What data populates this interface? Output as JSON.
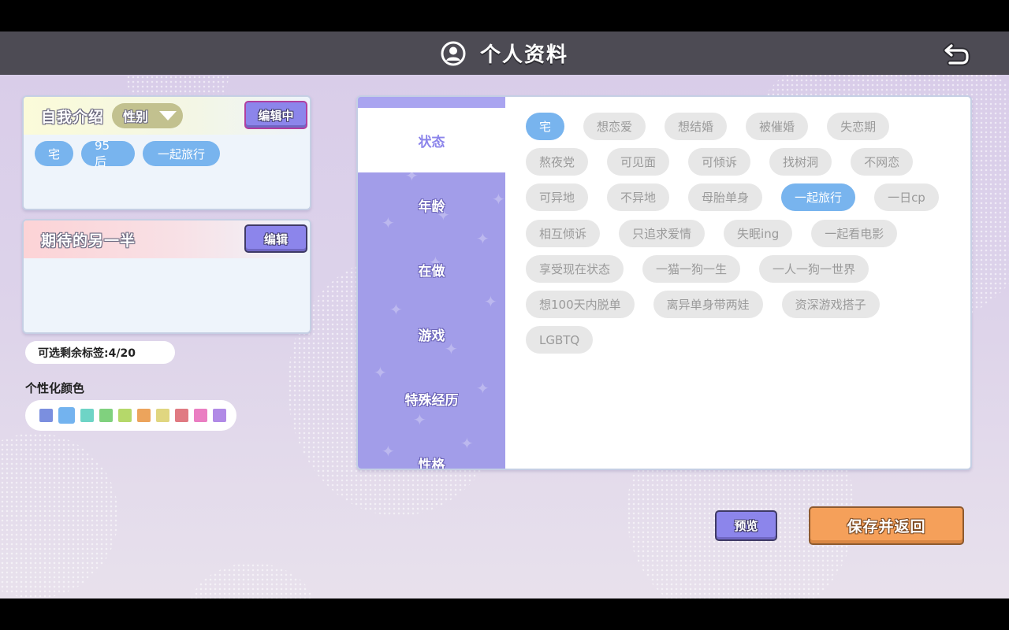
{
  "header": {
    "title": "个人资料",
    "profile_icon": "user-circle-icon",
    "back_icon": "return-arrow-icon"
  },
  "intro_card": {
    "title": "自我介绍",
    "gender_label": "性别",
    "edit_button": "编辑中",
    "selected_tags": [
      "宅",
      "95后",
      "一起旅行"
    ]
  },
  "partner_card": {
    "title": "期待的另一半",
    "edit_button": "编辑"
  },
  "remaining_tags": "可选剩余标签:4/20",
  "colors": {
    "label": "个性化颜色",
    "swatches": [
      "#7b8fdf",
      "#73b3ef",
      "#6ed4c6",
      "#80d17e",
      "#b5d86a",
      "#eca45c",
      "#e0d680",
      "#e07a82",
      "#ea7ec2",
      "#b18ae6"
    ],
    "selected_index": 1,
    "accent_purple": "#8c85eb",
    "accent_orange": "#f5a05a",
    "tag_selected_blue": "#78b4ee"
  },
  "categories": {
    "items": [
      "状态",
      "年龄",
      "在做",
      "游戏",
      "特殊经历",
      "性格"
    ],
    "active_index": 0
  },
  "tags": {
    "rows": [
      [
        {
          "label": "宅",
          "sel": true
        },
        {
          "label": "想恋爱"
        },
        {
          "label": "想结婚"
        },
        {
          "label": "被催婚"
        },
        {
          "label": "失恋期"
        }
      ],
      [
        {
          "label": "熬夜党"
        },
        {
          "label": "可见面"
        },
        {
          "label": "可倾诉"
        },
        {
          "label": "找树洞"
        },
        {
          "label": "不网恋"
        }
      ],
      [
        {
          "label": "可异地"
        },
        {
          "label": "不异地"
        },
        {
          "label": "母胎单身"
        },
        {
          "label": "一起旅行",
          "sel": true
        },
        {
          "label": "一日cp"
        }
      ],
      [
        {
          "label": "相互倾诉"
        },
        {
          "label": "只追求爱情"
        },
        {
          "label": "失眠ing"
        },
        {
          "label": "一起看电影"
        }
      ],
      [
        {
          "label": "享受现在状态"
        },
        {
          "label": "一猫一狗一生"
        },
        {
          "label": "一人一狗一世界"
        }
      ],
      [
        {
          "label": "想100天内脱单"
        },
        {
          "label": "离异单身带两娃"
        },
        {
          "label": "资深游戏搭子"
        }
      ],
      [
        {
          "label": "LGBTQ"
        }
      ]
    ]
  },
  "footer": {
    "preview_button": "预览",
    "save_button": "保存并返回"
  }
}
